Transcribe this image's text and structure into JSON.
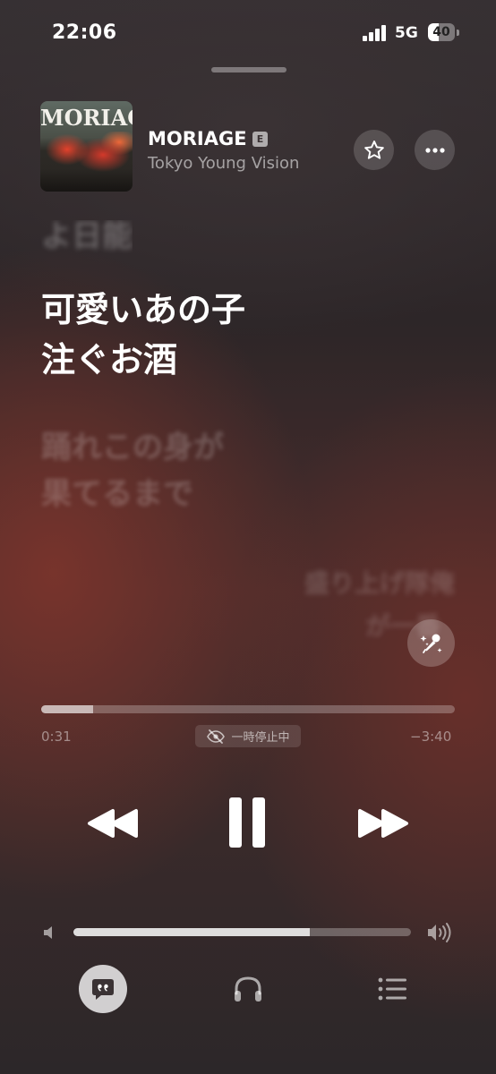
{
  "status_bar": {
    "time": "22:06",
    "network": "5G",
    "battery": "40",
    "battery_level": 0.4
  },
  "now_playing": {
    "album_art_text": "MORIAGE",
    "title": "MORIAGE",
    "explicit_badge": "E",
    "artist": "Tokyo Young Vision"
  },
  "lyrics": {
    "previous_line": "よ日能",
    "current_lines": [
      "可愛いあの子",
      "注ぐお酒"
    ],
    "next_lines": [
      "踊れこの身が",
      "果てるまで"
    ],
    "background_vocal_lines": [
      "盛り上げ隊俺",
      "が一番"
    ]
  },
  "playback": {
    "elapsed": "0:31",
    "remaining": "−3:40",
    "progress": 0.125,
    "paused_label": "一時停止中"
  },
  "volume": {
    "level": 0.7
  },
  "icons": {
    "favorite": "star-icon",
    "more": "ellipsis-icon",
    "sing": "microphone-sparkle-icon",
    "rewind": "rewind-icon",
    "pause": "pause-icon",
    "forward": "fast-forward-icon",
    "lyrics": "lyrics-bubble-icon",
    "airplay": "headphones-icon",
    "queue": "list-icon"
  }
}
